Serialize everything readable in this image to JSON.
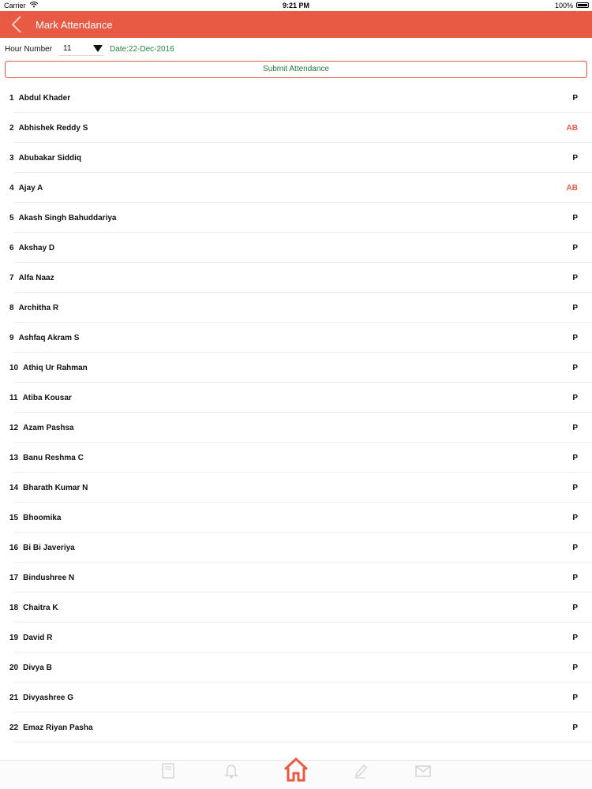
{
  "status_bar": {
    "carrier": "Carrier",
    "time": "9:21 PM",
    "battery": "100%"
  },
  "nav": {
    "title": "Mark Attendance"
  },
  "controls": {
    "hour_label": "Hour Number",
    "hour_value": "11",
    "date": "Date:22-Dec-2016"
  },
  "submit_label": "Submit Attendance",
  "students": [
    {
      "num": "1",
      "name": "Abdul Khader",
      "status": "P"
    },
    {
      "num": "2",
      "name": "Abhishek Reddy S",
      "status": "AB"
    },
    {
      "num": "3",
      "name": "Abubakar Siddiq",
      "status": "P"
    },
    {
      "num": "4",
      "name": "Ajay A",
      "status": "AB"
    },
    {
      "num": "5",
      "name": "Akash Singh Bahuddariya",
      "status": "P"
    },
    {
      "num": "6",
      "name": "Akshay D",
      "status": "P"
    },
    {
      "num": "7",
      "name": "Alfa Naaz",
      "status": "P"
    },
    {
      "num": "8",
      "name": "Architha R",
      "status": "P"
    },
    {
      "num": "9",
      "name": "Ashfaq Akram S",
      "status": "P"
    },
    {
      "num": "10",
      "name": "Athiq Ur Rahman",
      "status": "P"
    },
    {
      "num": "11",
      "name": "Atiba Kousar",
      "status": "P"
    },
    {
      "num": "12",
      "name": "Azam Pashsa",
      "status": "P"
    },
    {
      "num": "13",
      "name": "Banu Reshma C",
      "status": "P"
    },
    {
      "num": "14",
      "name": "Bharath Kumar N",
      "status": "P"
    },
    {
      "num": "15",
      "name": "Bhoomika",
      "status": "P"
    },
    {
      "num": "16",
      "name": "Bi Bi Javeriya",
      "status": "P"
    },
    {
      "num": "17",
      "name": "Bindushree N",
      "status": "P"
    },
    {
      "num": "18",
      "name": "Chaitra K",
      "status": "P"
    },
    {
      "num": "19",
      "name": "David R",
      "status": "P"
    },
    {
      "num": "20",
      "name": "Divya B",
      "status": "P"
    },
    {
      "num": "21",
      "name": "Divyashree G",
      "status": "P"
    },
    {
      "num": "22",
      "name": "Emaz Riyan Pasha",
      "status": "P"
    }
  ],
  "tabs": [
    {
      "icon": "notebook-icon",
      "label": ""
    },
    {
      "icon": "bell-icon",
      "label": ""
    },
    {
      "icon": "home-icon",
      "label": ""
    },
    {
      "icon": "pencil-icon",
      "label": ""
    },
    {
      "icon": "envelope-icon",
      "label": ""
    }
  ],
  "colors": {
    "accent": "#e95a45",
    "date_green": "#208a3c",
    "absent": "#e95a45"
  }
}
